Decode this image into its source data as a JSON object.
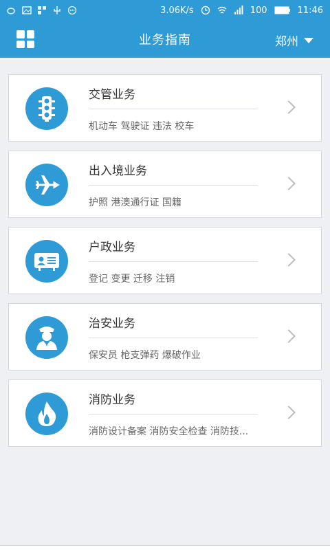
{
  "status_bar": {
    "speed": "3.06K/s",
    "battery": "100",
    "time": "11:46"
  },
  "header": {
    "title": "业务指南",
    "city": "郑州"
  },
  "colors": {
    "accent": "#2e9ad6"
  },
  "cards": [
    {
      "title": "交管业务",
      "subtitle": "机动车  驾驶证  违法  校车",
      "icon": "traffic-light-icon"
    },
    {
      "title": "出入境业务",
      "subtitle": "护照  港澳通行证  国籍",
      "icon": "airplane-icon"
    },
    {
      "title": "户政业务",
      "subtitle": "登记  变更  迁移  注销",
      "icon": "id-card-icon"
    },
    {
      "title": "治安业务",
      "subtitle": "保安员  枪支弹药  爆破作业",
      "icon": "police-officer-icon"
    },
    {
      "title": "消防业务",
      "subtitle": "消防设计备案  消防安全检查  消防技...",
      "icon": "fire-icon"
    }
  ]
}
